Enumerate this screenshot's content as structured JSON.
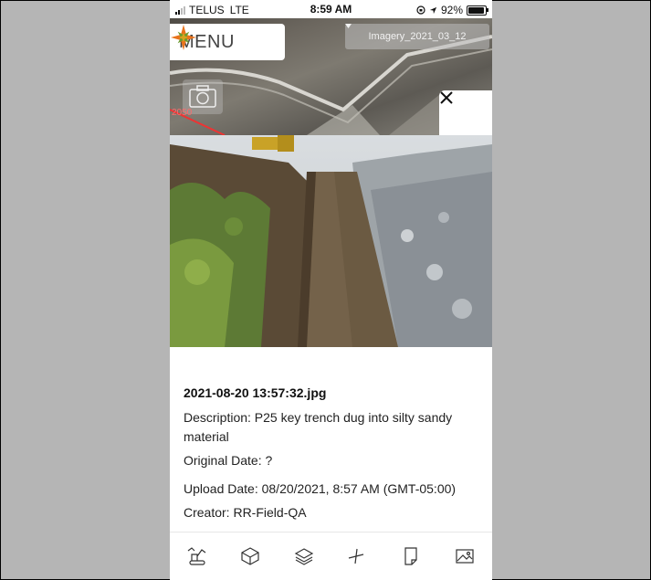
{
  "status_bar": {
    "carrier": "TELUS",
    "network": "LTE",
    "time": "8:59 AM",
    "battery": "92%",
    "battery_level": 0.92
  },
  "map": {
    "menu_label": "MENU",
    "imagery_selected": "Imagery_2021_03_12",
    "scale_label": "2050"
  },
  "photo_details": {
    "filename": "2021-08-20 13:57:32.jpg",
    "description": "Description: P25 key trench dug into silty sandy material",
    "original_date": "Original Date: ?",
    "upload_date": "Upload Date: 08/20/2021, 8:57 AM (GMT-05:00)",
    "creator": "Creator: RR-Field-QA"
  },
  "toolbar": {
    "icons": [
      "excavator-icon",
      "box-3d-icon",
      "layers-icon",
      "measure-icon",
      "document-icon",
      "image-icon"
    ]
  },
  "colors": {
    "logo_orange": "#e8731c",
    "logo_green": "#6a9a2f",
    "logo_gold": "#d7a21e",
    "scale_red": "#ff6a6a"
  }
}
